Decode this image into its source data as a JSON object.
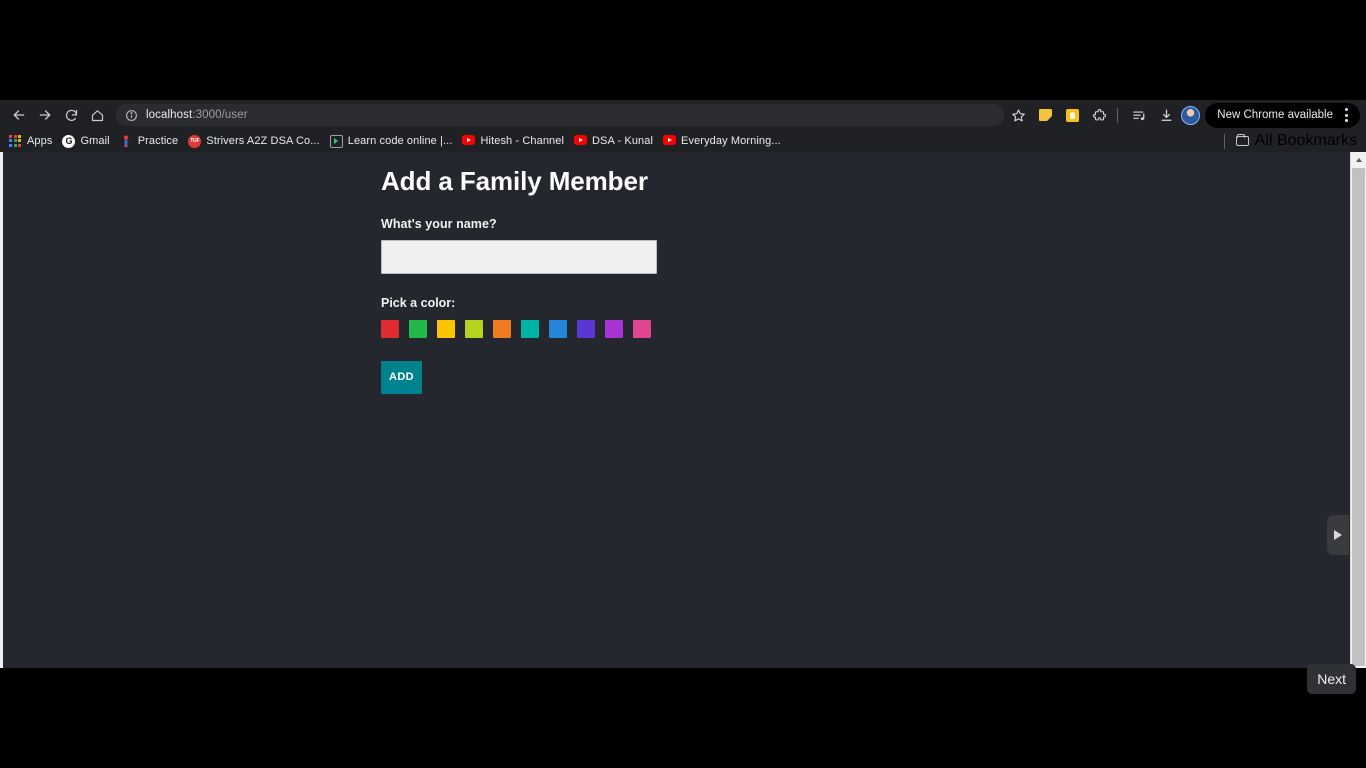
{
  "browser": {
    "nav": {
      "back_icon": "arrow-left-icon",
      "forward_icon": "arrow-right-icon",
      "reload_icon": "reload-icon",
      "home_icon": "home-icon"
    },
    "omnibox": {
      "site_info_icon": "info-circle-icon",
      "url_host": "localhost",
      "url_rest": ":3000/user",
      "url_full": "localhost:3000/user",
      "star_icon": "bookmark-star-icon"
    },
    "toolbar_icons": [
      {
        "name": "sticky-note-extension-icon",
        "color": "#f5c43c"
      },
      {
        "name": "lightbulb-extension-icon",
        "color": "#f5bf2a"
      },
      {
        "name": "extensions-puzzle-icon",
        "color": "#d6d8db"
      },
      {
        "name": "media-playlist-icon",
        "color": "#d6d8db"
      },
      {
        "name": "downloads-icon",
        "color": "#d6d8db"
      }
    ],
    "avatar_name": "profile-avatar",
    "update_label": "New Chrome available",
    "menu_icon": "kebab-menu-icon"
  },
  "bookmarks": {
    "items": [
      {
        "label": "Apps",
        "icon": "apps-grid-icon"
      },
      {
        "label": "Gmail",
        "icon": "gmail-icon"
      },
      {
        "label": "Practice",
        "icon": "practice-icon"
      },
      {
        "label": "Strivers A2Z DSA Co...",
        "icon": "strivers-icon"
      },
      {
        "label": "Learn code online |...",
        "icon": "learn-code-icon"
      },
      {
        "label": "Hitesh - Channel",
        "icon": "youtube-icon"
      },
      {
        "label": "DSA - Kunal",
        "icon": "youtube-icon"
      },
      {
        "label": "Everyday Morning...",
        "icon": "youtube-icon"
      }
    ],
    "all_bookmarks_label": "All Bookmarks",
    "all_bookmarks_icon": "folder-icon"
  },
  "page": {
    "title": "Add a Family Member",
    "name_label": "What's your name?",
    "name_value": "",
    "name_placeholder": "",
    "color_label": "Pick a color:",
    "add_label": "ADD",
    "add_button_color": "#00838f",
    "background_color": "#24272e",
    "colors": [
      {
        "name": "red",
        "hex": "#e02b32"
      },
      {
        "name": "green",
        "hex": "#22b84a"
      },
      {
        "name": "amber",
        "hex": "#ffc400"
      },
      {
        "name": "lime",
        "hex": "#b5d41e"
      },
      {
        "name": "orange",
        "hex": "#f07c22"
      },
      {
        "name": "teal",
        "hex": "#00b3a4"
      },
      {
        "name": "blue",
        "hex": "#2585d6"
      },
      {
        "name": "indigo",
        "hex": "#5b35d5"
      },
      {
        "name": "purple",
        "hex": "#a733d4"
      },
      {
        "name": "pink",
        "hex": "#e0458f"
      }
    ]
  },
  "overlay": {
    "side_tab_icon": "play-arrow-icon",
    "next_label": "Next"
  }
}
